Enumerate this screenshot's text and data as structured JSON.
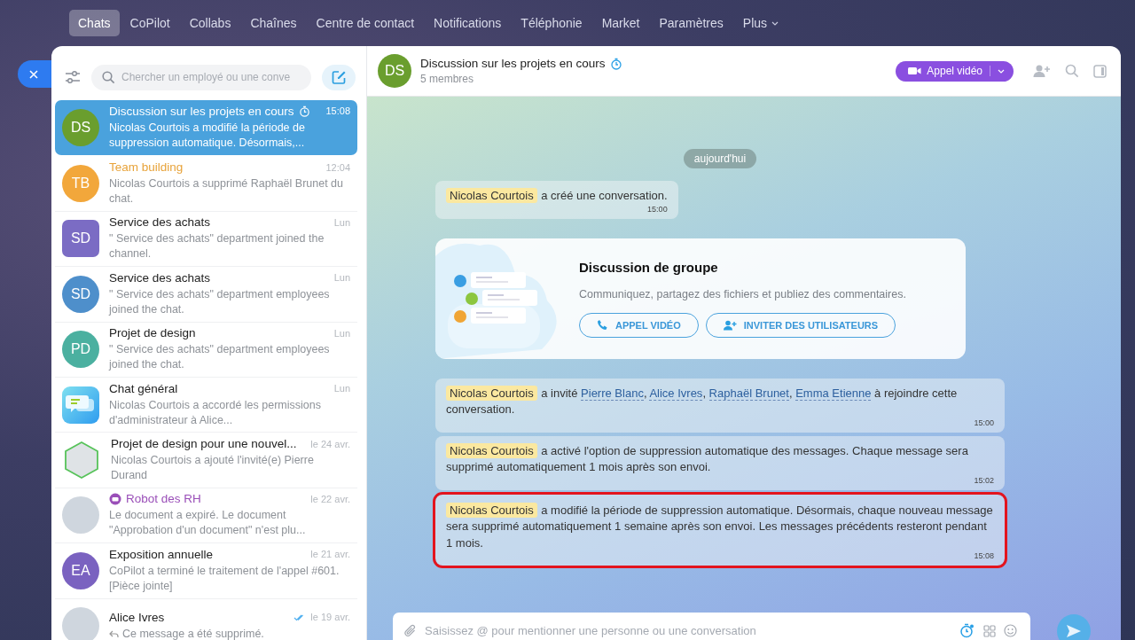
{
  "top_nav": [
    {
      "label": "Chats",
      "selected": true
    },
    {
      "label": "CoPilot",
      "selected": false
    },
    {
      "label": "Collabs",
      "selected": false
    },
    {
      "label": "Chaînes",
      "selected": false
    },
    {
      "label": "Centre de contact",
      "selected": false
    },
    {
      "label": "Notifications",
      "selected": false
    },
    {
      "label": "Téléphonie",
      "selected": false
    },
    {
      "label": "Market",
      "selected": false
    },
    {
      "label": "Paramètres",
      "selected": false
    },
    {
      "label": "Plus",
      "selected": false,
      "dropdown": true
    }
  ],
  "sidebar": {
    "search": {
      "placeholder": "Chercher un employé ou une conve"
    },
    "chats": [
      {
        "title": "Discussion sur les projets en cours",
        "time": "15:08",
        "preview": "Nicolas Courtois a modifié la période de suppression automatique. Désormais,...",
        "selected": true,
        "timer": true,
        "avatar": {
          "kind": "round",
          "text": "DS",
          "color": "#6a9e2e"
        }
      },
      {
        "title": "Team building",
        "time": "12:04",
        "preview": "Nicolas Courtois a supprimé Raphaël Brunet du chat.",
        "selected": false,
        "color": "#e8a33a",
        "avatar": {
          "kind": "round",
          "text": "TB",
          "color": "#f2a73b"
        }
      },
      {
        "title": "Service des achats",
        "time": "Lun",
        "preview": "\" Service des achats\" department joined the channel.",
        "selected": false,
        "avatar": {
          "kind": "square",
          "text": "SD",
          "color": "#7b6cc4"
        }
      },
      {
        "title": "Service des achats",
        "time": "Lun",
        "preview": "\" Service des achats\" department employees joined the chat.",
        "selected": false,
        "avatar": {
          "kind": "round",
          "text": "SD",
          "color": "#4e8fcb"
        }
      },
      {
        "title": "Projet de design",
        "time": "Lun",
        "preview": "\" Service des achats\" department employees joined the chat.",
        "selected": false,
        "avatar": {
          "kind": "round",
          "text": "PD",
          "color": "#4bb0a0"
        }
      },
      {
        "title": "Chat général",
        "time": "Lun",
        "preview": "Nicolas Courtois a accordé les permissions d'administrateur à Alice...",
        "selected": false,
        "avatar": {
          "kind": "app"
        }
      },
      {
        "title": "Projet de design pour une nouvel...",
        "time": "le 24 avr.",
        "preview": "Nicolas Courtois a ajouté l'invité(e) Pierre Durand",
        "selected": false,
        "avatar": {
          "kind": "hexagon"
        }
      },
      {
        "title": "Robot des RH",
        "time": "le 22 avr.",
        "preview": "Le document a expiré. Le document \"Approbation d'un document\" n'est plu...",
        "selected": false,
        "bot": true,
        "color": "#9a4fb8",
        "avatar": {
          "kind": "photo"
        }
      },
      {
        "title": "Exposition annuelle",
        "time": "le 21 avr.",
        "preview": "CoPilot a terminé le traitement de l'appel #601. [Pièce jointe]",
        "selected": false,
        "avatar": {
          "kind": "round",
          "text": "EA",
          "color": "#7a62c0"
        }
      },
      {
        "title": "Alice Ivres",
        "time": "le 19 avr.",
        "preview": "Ce message a été supprimé.",
        "selected": false,
        "read": true,
        "reply": true,
        "avatar": {
          "kind": "photo"
        }
      }
    ]
  },
  "header": {
    "avatar": {
      "text": "DS",
      "color": "#6a9e2e"
    },
    "title": "Discussion sur les projets en cours",
    "timer": true,
    "subtitle": "5 membres",
    "call_button": "Appel vidéo"
  },
  "date_pill": "aujourd'hui",
  "messages": [
    {
      "kind": "system",
      "highlighted": false,
      "time": "15:00",
      "parts": [
        {
          "kind": "name",
          "text": "Nicolas Courtois"
        },
        {
          "kind": "text",
          "text": " a créé une conversation."
        }
      ]
    },
    {
      "kind": "welcome",
      "title": "Discussion de groupe",
      "text": "Communiquez, partagez des fichiers et publiez des commentaires.",
      "buttons": [
        {
          "kind": "call",
          "label": "APPEL VIDÉO"
        },
        {
          "kind": "invite",
          "label": "INVITER DES UTILISATEURS"
        }
      ]
    },
    {
      "kind": "system",
      "highlighted": false,
      "time": "15:00",
      "parts": [
        {
          "kind": "name",
          "text": "Nicolas Courtois"
        },
        {
          "kind": "text",
          "text": " a invité "
        },
        {
          "kind": "link",
          "text": "Pierre Blanc"
        },
        {
          "kind": "text",
          "text": ", "
        },
        {
          "kind": "link",
          "text": "Alice Ivres"
        },
        {
          "kind": "text",
          "text": ", "
        },
        {
          "kind": "link",
          "text": "Raphaël Brunet"
        },
        {
          "kind": "text",
          "text": ", "
        },
        {
          "kind": "link",
          "text": "Emma Etienne"
        },
        {
          "kind": "text",
          "text": " à rejoindre cette conversation."
        }
      ]
    },
    {
      "kind": "system",
      "highlighted": false,
      "time": "15:02",
      "parts": [
        {
          "kind": "name",
          "text": "Nicolas Courtois"
        },
        {
          "kind": "text",
          "text": " a activé l'option de suppression automatique des messages. Chaque message sera supprimé automatiquement 1 mois après son envoi."
        }
      ]
    },
    {
      "kind": "system",
      "highlighted": true,
      "time": "15:08",
      "parts": [
        {
          "kind": "name",
          "text": "Nicolas Courtois"
        },
        {
          "kind": "text",
          "text": " a modifié la période de suppression automatique. Désormais, chaque nouveau message sera supprimé automatiquement 1 semaine après son envoi. Les messages précédents resteront pendant 1 mois."
        }
      ]
    }
  ],
  "composer": {
    "placeholder": "Saisissez @ pour mentionner une personne ou une conversation"
  }
}
